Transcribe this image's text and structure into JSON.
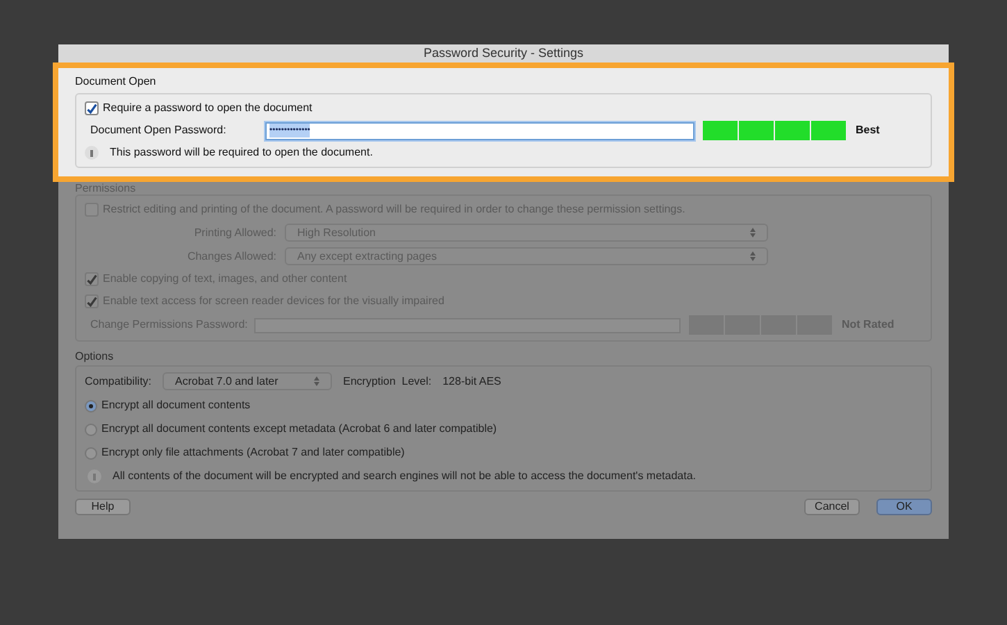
{
  "window": {
    "title": "Password Security - Settings"
  },
  "document_open": {
    "title": "Document Open",
    "require": {
      "label": "Require a password to open the document",
      "checked": true
    },
    "password": {
      "label": "Document Open Password:",
      "value": "••••••••••••••",
      "focused": true
    },
    "strength": {
      "level": 1,
      "label": "Best"
    },
    "note": "This password will be required to open the document."
  },
  "permissions": {
    "title": "Permissions",
    "restrict": {
      "label": "Restrict editing and printing of the document. A password will be required in order to change these permission settings.",
      "checked": false
    },
    "selects": [
      {
        "label": "Printing Allowed:",
        "value": "High Resolution"
      },
      {
        "label": "Changes Allowed:",
        "value": "Any except extracting pages"
      }
    ],
    "options": [
      {
        "label": "Enable copying of text, images, and other content",
        "checked": true
      },
      {
        "label": "Enable text access for screen reader devices for the visually impaired",
        "checked": true
      }
    ],
    "password": {
      "label": "Change Permissions Password:"
    },
    "strength": {
      "level": 0,
      "label": "Not Rated"
    }
  },
  "options": {
    "title": "Options",
    "compatibility": {
      "label": "Compatibility:",
      "value": "Acrobat 7.0 and later"
    },
    "encryption": {
      "label": "Encryption  Level:",
      "value": "128-bit AES"
    },
    "radios": [
      {
        "label": "Encrypt all document contents",
        "selected": true
      },
      {
        "label": "Encrypt all document contents except metadata (Acrobat 6 and later compatible)",
        "selected": false
      },
      {
        "label": "Encrypt only file attachments (Acrobat 7 and later compatible)",
        "selected": false
      }
    ],
    "note": "All contents of the document will be encrypted and search engines will not be able to access the document's metadata."
  },
  "buttons": [
    {
      "label": "Help",
      "kind": "plain"
    },
    {
      "label": "Cancel",
      "kind": "plain"
    },
    {
      "label": "OK",
      "kind": "default"
    }
  ]
}
